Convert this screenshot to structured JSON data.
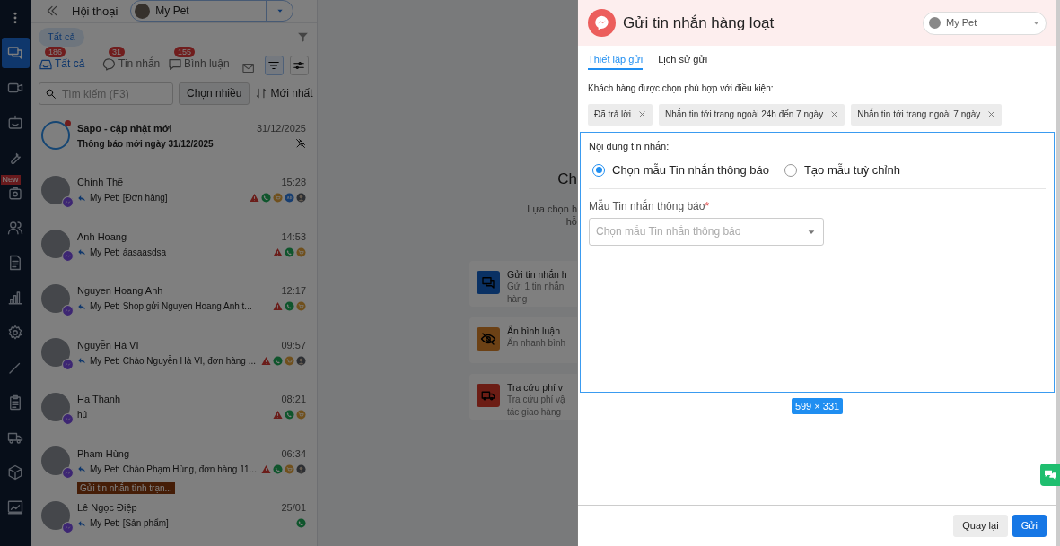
{
  "rail": {
    "items": [
      {
        "kind": "chat",
        "selected": true
      },
      {
        "kind": "video",
        "selected": false
      },
      {
        "kind": "bot",
        "selected": false
      },
      {
        "kind": "wrench",
        "selected": false
      },
      {
        "kind": "bag",
        "selected": false,
        "badge": "New"
      },
      {
        "kind": "users",
        "selected": false
      },
      {
        "kind": "doc",
        "selected": false
      },
      {
        "kind": "chart",
        "selected": false
      },
      {
        "kind": "gear",
        "selected": false
      },
      {
        "kind": "pencil",
        "selected": false
      },
      {
        "kind": "clipboard",
        "selected": false
      },
      {
        "kind": "truck",
        "selected": false
      },
      {
        "kind": "box",
        "selected": false
      },
      {
        "kind": "report",
        "selected": false
      }
    ]
  },
  "header": {
    "title": "Hội thoại",
    "page_select": "My Pet"
  },
  "filter_chip": "Tất cả",
  "tabs": [
    {
      "label": "Tất cả",
      "count": "186",
      "kind": "inbox",
      "selected": true
    },
    {
      "label": "Tin nhắn",
      "count": "31",
      "kind": "messenger",
      "selected": false
    },
    {
      "label": "Bình luận",
      "count": "155",
      "kind": "comment",
      "selected": false
    }
  ],
  "search": {
    "placeholder": "Tìm kiếm (F3)"
  },
  "select_button": "Chọn nhiều",
  "sort": "Mới nhất",
  "conversations": [
    {
      "kind": "system",
      "name": "Sapo - cập nhật mới",
      "time": "31/12/2025",
      "preview": "Thông báo mới ngày 31/12/2025",
      "unread": true,
      "replied": false,
      "pinned": true
    },
    {
      "kind": "contact",
      "name": "Chính Thế",
      "time": "15:28",
      "preview": "My Pet: [Đơn hàng]",
      "unread": false,
      "replied": true,
      "pinned": false,
      "icons": [
        {
          "kind": "warning"
        },
        {
          "kind": "phone"
        },
        {
          "kind": "cart"
        },
        {
          "kind": "ads"
        },
        {
          "kind": "avatar"
        }
      ]
    },
    {
      "kind": "contact",
      "name": "Anh Hoang",
      "time": "14:53",
      "preview": "My Pet: áasaasdsa",
      "unread": false,
      "replied": true,
      "pinned": false,
      "icons": [
        {
          "kind": "warning"
        },
        {
          "kind": "phone"
        },
        {
          "kind": "cart"
        }
      ]
    },
    {
      "kind": "contact",
      "name": "Nguyen Hoang Anh",
      "time": "12:17",
      "preview": "My Pet: Shop gửi Nguyen Hoang Anh t...",
      "unread": false,
      "replied": true,
      "pinned": false,
      "icons": [
        {
          "kind": "warning"
        },
        {
          "kind": "phone"
        },
        {
          "kind": "cart"
        }
      ]
    },
    {
      "kind": "contact",
      "name": "Nguyễn Hà VI",
      "time": "09:57",
      "preview": "My Pet: Chào Nguyễn Hà VI, đơn hàng ...",
      "unread": false,
      "replied": true,
      "pinned": false,
      "icons": [
        {
          "kind": "warning"
        },
        {
          "kind": "phone"
        },
        {
          "kind": "cart"
        },
        {
          "kind": "avatar"
        }
      ]
    },
    {
      "kind": "contact",
      "name": "Ha Thanh",
      "time": "08:21",
      "preview": "hú",
      "unread": false,
      "replied": false,
      "pinned": false,
      "icons": [
        {
          "kind": "warning"
        },
        {
          "kind": "phone"
        },
        {
          "kind": "cart"
        }
      ]
    },
    {
      "kind": "contact",
      "name": "Phạm Hùng",
      "time": "06:34",
      "preview": "My Pet: Chào Phạm Hùng, đơn hàng 11...",
      "unread": false,
      "replied": true,
      "pinned": false,
      "icons": [
        {
          "kind": "warning"
        },
        {
          "kind": "phone"
        },
        {
          "kind": "cart"
        },
        {
          "kind": "avatar"
        }
      ],
      "tag": "Gửi tin nhắn tình trạn..."
    },
    {
      "kind": "contact",
      "name": "Lê Ngọc Điệp",
      "time": "25/01",
      "preview": "My Pet: [Sản phẩm]",
      "unread": false,
      "replied": true,
      "pinned": false,
      "icons": [
        {
          "kind": "phone"
        }
      ]
    }
  ],
  "center": {
    "heading": "Ch",
    "subtitle": [
      "Lựa chọn h",
      "hỗ"
    ],
    "cards": [
      {
        "kind": "chat",
        "title": "Gửi tin nhắn h",
        "lines": [
          "Gửi 1 tin nhắn",
          "hàng"
        ]
      },
      {
        "kind": "hide",
        "title": "Ẩn bình luận",
        "lines": [
          "Ẩn nhanh bình"
        ]
      },
      {
        "kind": "truck",
        "title": "Tra cứu phí v",
        "lines": [
          "Tra cứu phí vậ",
          "tác giao hàng"
        ]
      }
    ]
  },
  "drawer": {
    "title": "Gửi tin nhắn hàng loạt",
    "page_select": "My Pet",
    "tabs": [
      {
        "label": "Thiết lập gửi",
        "selected": true
      },
      {
        "label": "Lịch sử gửi",
        "selected": false
      }
    ],
    "conditions_label": "Khách hàng được chọn phù hợp với điều kiện:",
    "conditions": [
      "Đã trả lời",
      "Nhắn tin tới trang ngoài 24h đến 7 ngày",
      "Nhắn tin tới trang ngoài 7 ngày"
    ],
    "content_label": "Nội dung tin nhắn:",
    "options": [
      {
        "label": "Chọn mẫu Tin nhắn thông báo",
        "selected": true
      },
      {
        "label": "Tạo mẫu tuỳ chỉnh",
        "selected": false
      }
    ],
    "template_label": "Mẫu Tin nhắn thông báo",
    "required_mark": "*",
    "template_select": {
      "placeholder": "Chọn mẫu Tin nhắn thông báo"
    },
    "size_badge": "599 × 331",
    "buttons": [
      {
        "label": "Quay lại",
        "kind": "secondary"
      },
      {
        "label": "Gửi",
        "kind": "primary"
      }
    ]
  }
}
